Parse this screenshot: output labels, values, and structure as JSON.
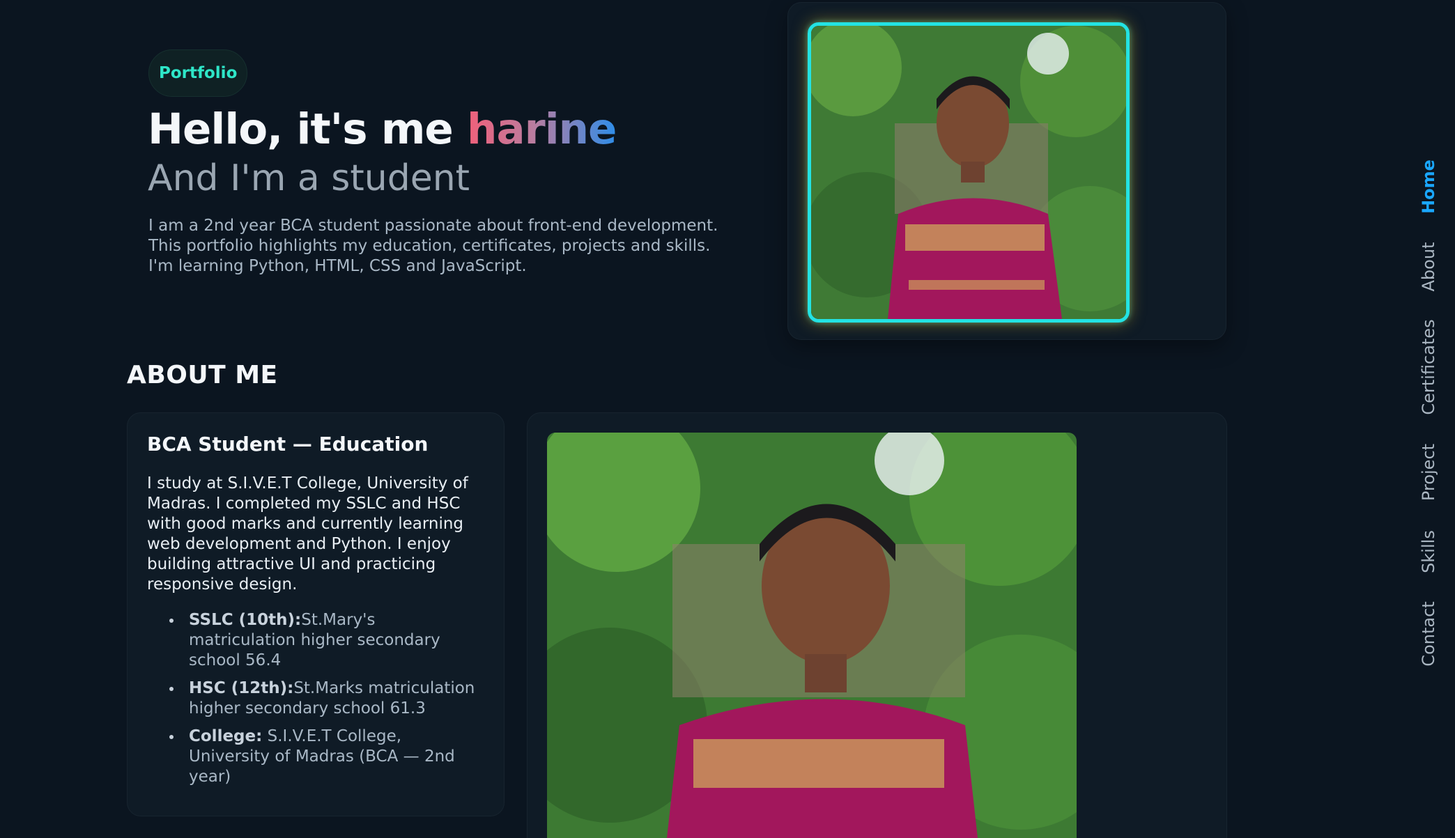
{
  "hero": {
    "badge": "Portfolio",
    "title_prefix": "Hello, it's me ",
    "name": "harine",
    "subtitle": "And I'm a student",
    "description": "I am a 2nd year BCA student passionate about front-end development. This portfolio highlights my education, certificates, projects and skills. I'm learning Python, HTML, CSS and JavaScript."
  },
  "about": {
    "heading": "ABOUT ME",
    "card_title": "BCA Student — Education",
    "body": "I study at S.I.V.E.T College, University of Madras. I completed my SSLC and HSC with good marks and currently learning web development and Python. I enjoy building attractive UI and practicing responsive design.",
    "education": [
      {
        "label": "SSLC (10th):",
        "value": "St.Mary's matriculation higher secondary school 56.4"
      },
      {
        "label": "HSC (12th):",
        "value": "St.Marks matriculation higher secondary school 61.3"
      },
      {
        "label": "College:",
        "value": " S.I.V.E.T College, University of Madras (BCA — 2nd year)"
      }
    ]
  },
  "nav": {
    "items": [
      "Home",
      "About",
      "Certificates",
      "Project",
      "Skills",
      "Contact"
    ],
    "active": "Home"
  },
  "colors": {
    "background": "#0b1520",
    "accent_teal": "#2ee6c8",
    "frame_cyan": "#23e3e3",
    "nav_active": "#1aa7ff",
    "name_gradient": [
      "#f0607a",
      "#2f8de8"
    ]
  }
}
